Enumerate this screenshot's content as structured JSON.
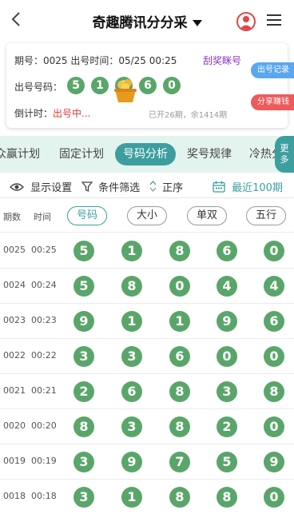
{
  "header": {
    "back_glyph": "<",
    "title": "奇趣腾讯分分采"
  },
  "draw_info": {
    "issue_text": "期号：0025 出号时间：05/25 00:25",
    "scratch_link": "刮奖眯号",
    "numbers_label": "出号号码：",
    "numbers": [
      "5",
      "1",
      "8",
      "6",
      "0"
    ],
    "countdown_label": "倒计时：",
    "countdown_status": "出号中...",
    "summary": "已开26期，余1414期",
    "tag_record": "出号记录",
    "tag_share": "分享赚钱"
  },
  "tabs": [
    "众赢计划",
    "固定计划",
    "号码分析",
    "奖号规律",
    "冷热分析"
  ],
  "active_tab": "号码分析",
  "more_tab": {
    "line1": "更",
    "line2": "多"
  },
  "toolbar": {
    "display_settings": "显示设置",
    "filter": "条件筛选",
    "sort": "正序",
    "recent": "最近100期"
  },
  "table": {
    "col_issue": "期数",
    "col_time": "时间",
    "filters": [
      "号码",
      "大小",
      "单双",
      "五行"
    ],
    "rows": [
      {
        "issue": "0025",
        "time": "00:25",
        "numbers": [
          "5",
          "1",
          "8",
          "6",
          "0"
        ]
      },
      {
        "issue": "0024",
        "time": "00:24",
        "numbers": [
          "5",
          "8",
          "0",
          "4",
          "4"
        ]
      },
      {
        "issue": "0023",
        "time": "00:23",
        "numbers": [
          "9",
          "1",
          "1",
          "9",
          "6"
        ]
      },
      {
        "issue": "0022",
        "time": "00:22",
        "numbers": [
          "3",
          "3",
          "6",
          "0",
          "0"
        ]
      },
      {
        "issue": "0021",
        "time": "00:21",
        "numbers": [
          "2",
          "6",
          "8",
          "3",
          "8"
        ]
      },
      {
        "issue": "0020",
        "time": "00:20",
        "numbers": [
          "8",
          "3",
          "8",
          "2",
          "0"
        ]
      },
      {
        "issue": "0019",
        "time": "00:19",
        "numbers": [
          "3",
          "9",
          "7",
          "5",
          "9"
        ]
      },
      {
        "issue": "0018",
        "time": "00:18",
        "numbers": [
          "3",
          "1",
          "8",
          "8",
          "0"
        ]
      }
    ]
  },
  "colors": {
    "accent": "#3d9e9e",
    "ball": "#5aa56a",
    "tab_bg": "#e3f4ee",
    "link": "#8b2fc9",
    "alert": "#e03a3a"
  }
}
